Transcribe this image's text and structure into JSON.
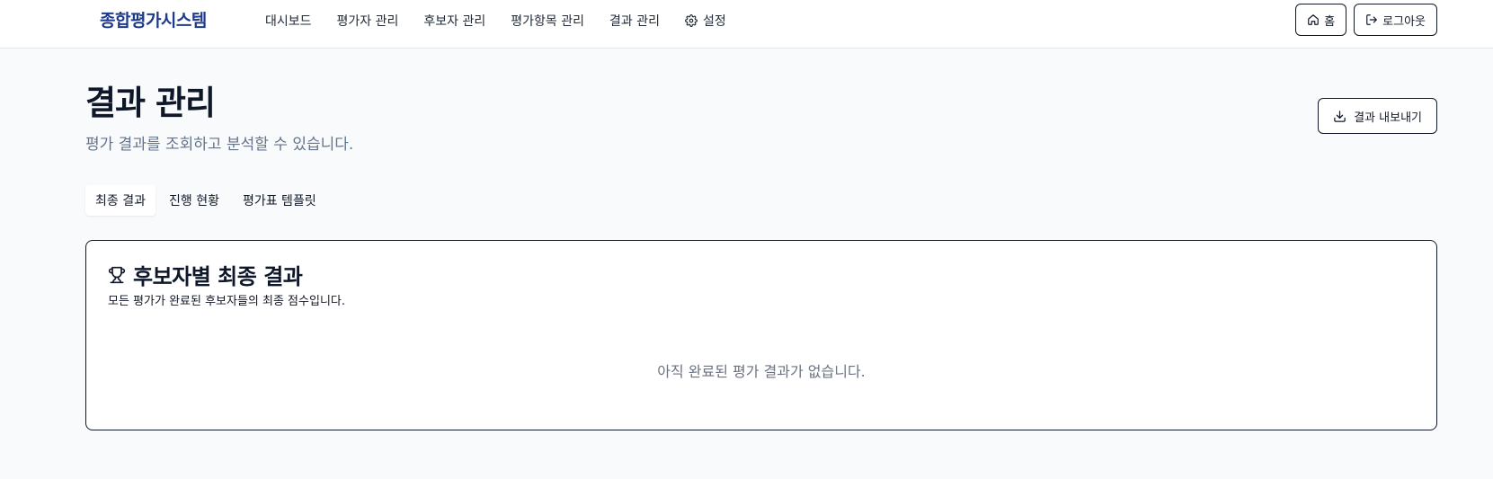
{
  "header": {
    "brand": "종합평가시스템",
    "nav": [
      {
        "label": "대시보드"
      },
      {
        "label": "평가자 관리"
      },
      {
        "label": "후보자 관리"
      },
      {
        "label": "평가항목 관리"
      },
      {
        "label": "결과 관리"
      },
      {
        "label": "설정",
        "icon": "gear-icon"
      }
    ],
    "home_label": "홈",
    "logout_label": "로그아웃"
  },
  "page": {
    "title": "결과 관리",
    "subtitle": "평가 결과를 조회하고 분석할 수 있습니다.",
    "export_label": "결과 내보내기"
  },
  "tabs": [
    {
      "label": "최종 결과",
      "active": true
    },
    {
      "label": "진행 현황",
      "active": false
    },
    {
      "label": "평가표 템플릿",
      "active": false
    }
  ],
  "card": {
    "icon": "trophy-icon",
    "title": "후보자별 최종 결과",
    "description": "모든 평가가 완료된 후보자들의 최종 점수입니다.",
    "empty_message": "아직 완료된 평가 결과가 없습니다."
  }
}
